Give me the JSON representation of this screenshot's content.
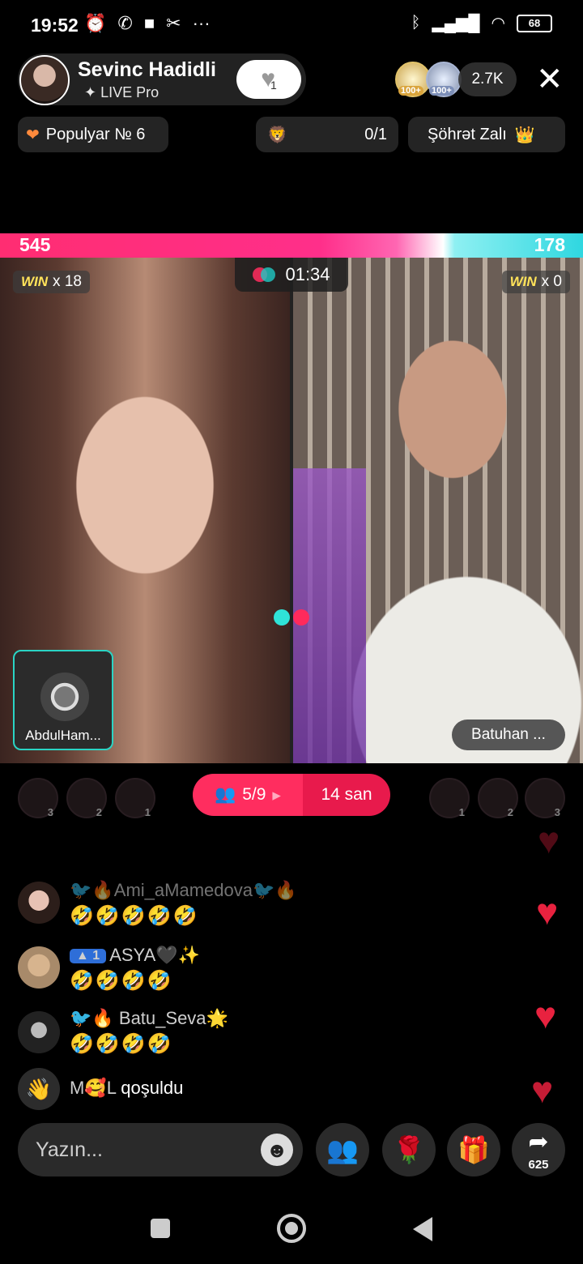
{
  "status_bar": {
    "time": "19:52",
    "battery": "68",
    "left_icons": [
      "alarm-icon",
      "whatsapp-icon",
      "video-icon",
      "missed-call-icon",
      "more-icon"
    ],
    "right_icons": [
      "bluetooth-icon",
      "signal-icon",
      "wifi-icon",
      "battery-icon"
    ]
  },
  "host": {
    "name": "Sevinc Hadidli",
    "subtitle": "LIVE Pro",
    "like_count": "1",
    "viewer_badges": [
      "100+",
      "100+"
    ],
    "viewer_count": "2.7K"
  },
  "chips": {
    "popular": "Populyar № 6",
    "goal": "0/1",
    "fame_hall": "Şöhrət Zalı"
  },
  "battle": {
    "score_left": "545",
    "score_right": "178",
    "score_left_value": 545,
    "score_right_value": 178,
    "timer": "01:34",
    "win_label": "WIN",
    "win_left": "x 18",
    "win_right": "x 0",
    "guest_name": "AbdulHam...",
    "opponent_name": "Batuhan ...",
    "participants": "5/9",
    "countdown": "14 san",
    "left_team_ranks": [
      "3",
      "2",
      "1"
    ],
    "right_team_ranks": [
      "1",
      "2",
      "3"
    ]
  },
  "comments": [
    {
      "name": "🐦🔥Ami_aMamedova🐦🔥",
      "text": "🤣🤣🤣🤣🤣"
    },
    {
      "level": "1",
      "name": "ASYA🖤✨",
      "text": "🤣🤣🤣🤣"
    },
    {
      "name": "🐦🔥 Batu_Seva🌟",
      "text": "🤣🤣🤣🤣"
    },
    {
      "name": "M🥰L",
      "text": "qoşuldu"
    }
  ],
  "composer": {
    "placeholder": "Yazın...",
    "share_count": "625"
  },
  "colors": {
    "accent_pink": "#ff2d5f",
    "accent_cyan": "#2fd7e0",
    "heart_red": "#e8223f"
  }
}
